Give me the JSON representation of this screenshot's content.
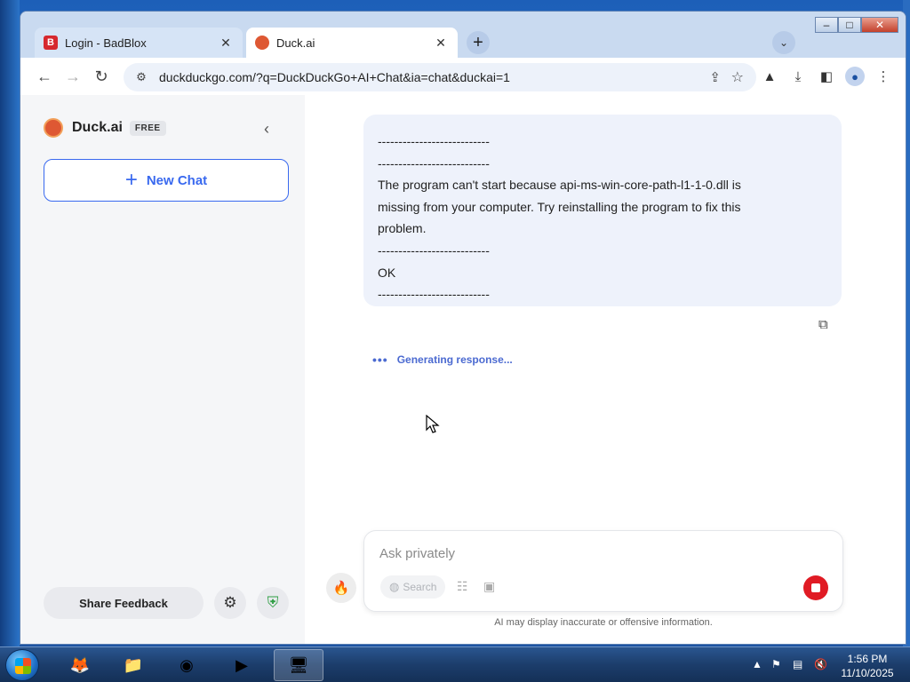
{
  "browser": {
    "tabs": [
      {
        "label": "Login - BadBlox",
        "favicon": "B",
        "active": false
      },
      {
        "label": "Duck.ai",
        "favicon": "duck",
        "active": true
      }
    ],
    "close_glyph": "✕",
    "new_tab_glyph": "+",
    "tab_search_glyph": "⌄",
    "url": "duckduckgo.com/?q=DuckDuckGo+AI+Chat&ia=chat&duckai=1"
  },
  "sidebar": {
    "brand_name": "Duck.ai",
    "brand_badge": "FREE",
    "new_chat_label": "New Chat",
    "share_feedback_label": "Share Feedback"
  },
  "chat": {
    "message_lines": [
      "---------------------------",
      "---------------------------",
      "The program can't start because api-ms-win-core-path-l1-1-0.dll is",
      "missing from your computer. Try reinstalling the program to fix this",
      "problem.",
      "---------------------------",
      "OK",
      "---------------------------"
    ],
    "generating_text": "Generating response...",
    "input_placeholder": "Ask privately",
    "search_label": "Search",
    "disclaimer": "AI may display inaccurate or offensive information."
  },
  "taskbar": {
    "time": "1:56 PM",
    "date": "11/10/2025"
  },
  "colors": {
    "accent": "#3969ef",
    "stop_button": "#e01b24",
    "brand_orange": "#de5833",
    "message_bg": "#eef2fb"
  }
}
